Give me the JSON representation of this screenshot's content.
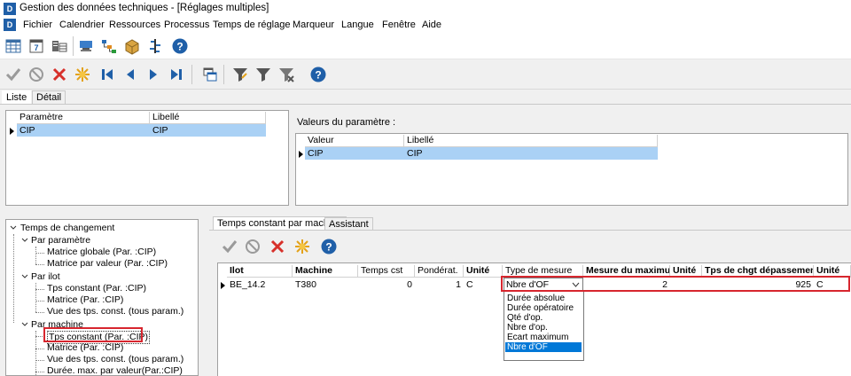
{
  "window": {
    "title": "Gestion des données techniques - [Réglages multiples]",
    "app_badge": "D"
  },
  "menu": [
    "Fichier",
    "Calendrier",
    "Ressources",
    "Processus",
    "Temps de réglage",
    "Marqueur",
    "Langue",
    "Fenêtre",
    "Aide"
  ],
  "main_tabs": {
    "list": "Liste",
    "detail": "Détail"
  },
  "param_table": {
    "headers": [
      "Paramètre",
      "Libellé"
    ],
    "rows": [
      [
        "CIP",
        "CIP"
      ]
    ]
  },
  "values_section": {
    "label": "Valeurs du paramètre :",
    "headers": [
      "Valeur",
      "Libellé"
    ],
    "rows": [
      [
        "CIP",
        "CIP"
      ]
    ]
  },
  "tree": {
    "root": "Temps de changement",
    "groups": [
      {
        "label": "Par paramètre",
        "items": [
          "Matrice globale (Par. :CIP)",
          "Matrice par valeur (Par. :CIP)"
        ]
      },
      {
        "label": "Par ilot",
        "items": [
          "Tps constant (Par. :CIP)",
          "Matrice (Par. :CIP)",
          "Vue des tps. const. (tous param.)"
        ]
      },
      {
        "label": "Par machine",
        "items": [
          "Tps constant (Par. :CIP)",
          "Matrice (Par. :CIP)",
          "Vue des tps. const. (tous param.)",
          "Durée. max. par valeur(Par.:CIP)"
        ]
      }
    ]
  },
  "detail_tabs": {
    "active": "Temps constant par machine",
    "other": "Assistant"
  },
  "grid": {
    "headers": [
      "Ilot",
      "Machine",
      "Temps cst",
      "Pondérat.",
      "Unité",
      "Type de mesure",
      "Mesure du maximum",
      "Unité",
      "Tps de chgt dépassement",
      "Unité"
    ],
    "row": {
      "ilot": "BE_14.2",
      "machine": "T380",
      "temps_cst": "0",
      "ponderat": "1",
      "unite": "C",
      "type_mesure": "Nbre d'OF",
      "mesure_max": "2",
      "tps_chgt": "925",
      "unite2": "C"
    }
  },
  "dropdown": {
    "options": [
      "Durée absolue",
      "Durée opératoire",
      "Qté d'op.",
      "Nbre d'op.",
      "Ecart maximum",
      "Nbre d'OF"
    ],
    "selected": "Nbre d'OF"
  },
  "colors": {
    "selection": "#aad1f5",
    "highlight": "#0078d7",
    "annotation": "#d7262e",
    "accent": "#1f5fa8"
  }
}
